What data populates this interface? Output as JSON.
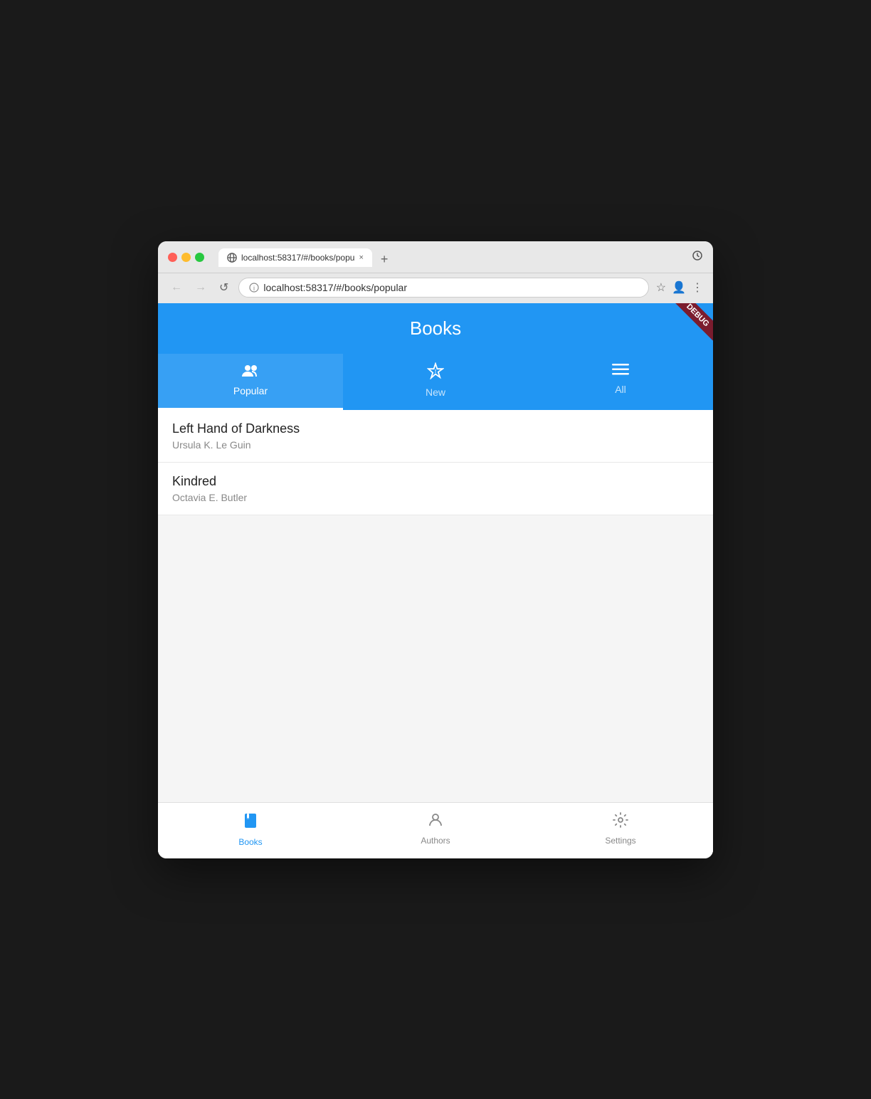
{
  "browser": {
    "url": "localhost:58317/#/books/popular",
    "url_display": "localhost:58317/#/books/popular",
    "tab_label": "localhost:58317/#/books/popu",
    "tab_close": "×",
    "tab_add": "+",
    "back_btn": "←",
    "forward_btn": "→",
    "refresh_btn": "↺"
  },
  "app": {
    "title": "Books",
    "debug_label": "DEBUG"
  },
  "nav_tabs": [
    {
      "id": "popular",
      "label": "Popular",
      "icon": "people",
      "active": true
    },
    {
      "id": "new",
      "label": "New",
      "icon": "new-badge",
      "active": false
    },
    {
      "id": "all",
      "label": "All",
      "icon": "list",
      "active": false
    }
  ],
  "books": [
    {
      "title": "Left Hand of Darkness",
      "author": "Ursula K. Le Guin"
    },
    {
      "title": "Kindred",
      "author": "Octavia E. Butler"
    }
  ],
  "bottom_nav": [
    {
      "id": "books",
      "label": "Books",
      "active": true
    },
    {
      "id": "authors",
      "label": "Authors",
      "active": false
    },
    {
      "id": "settings",
      "label": "Settings",
      "active": false
    }
  ]
}
